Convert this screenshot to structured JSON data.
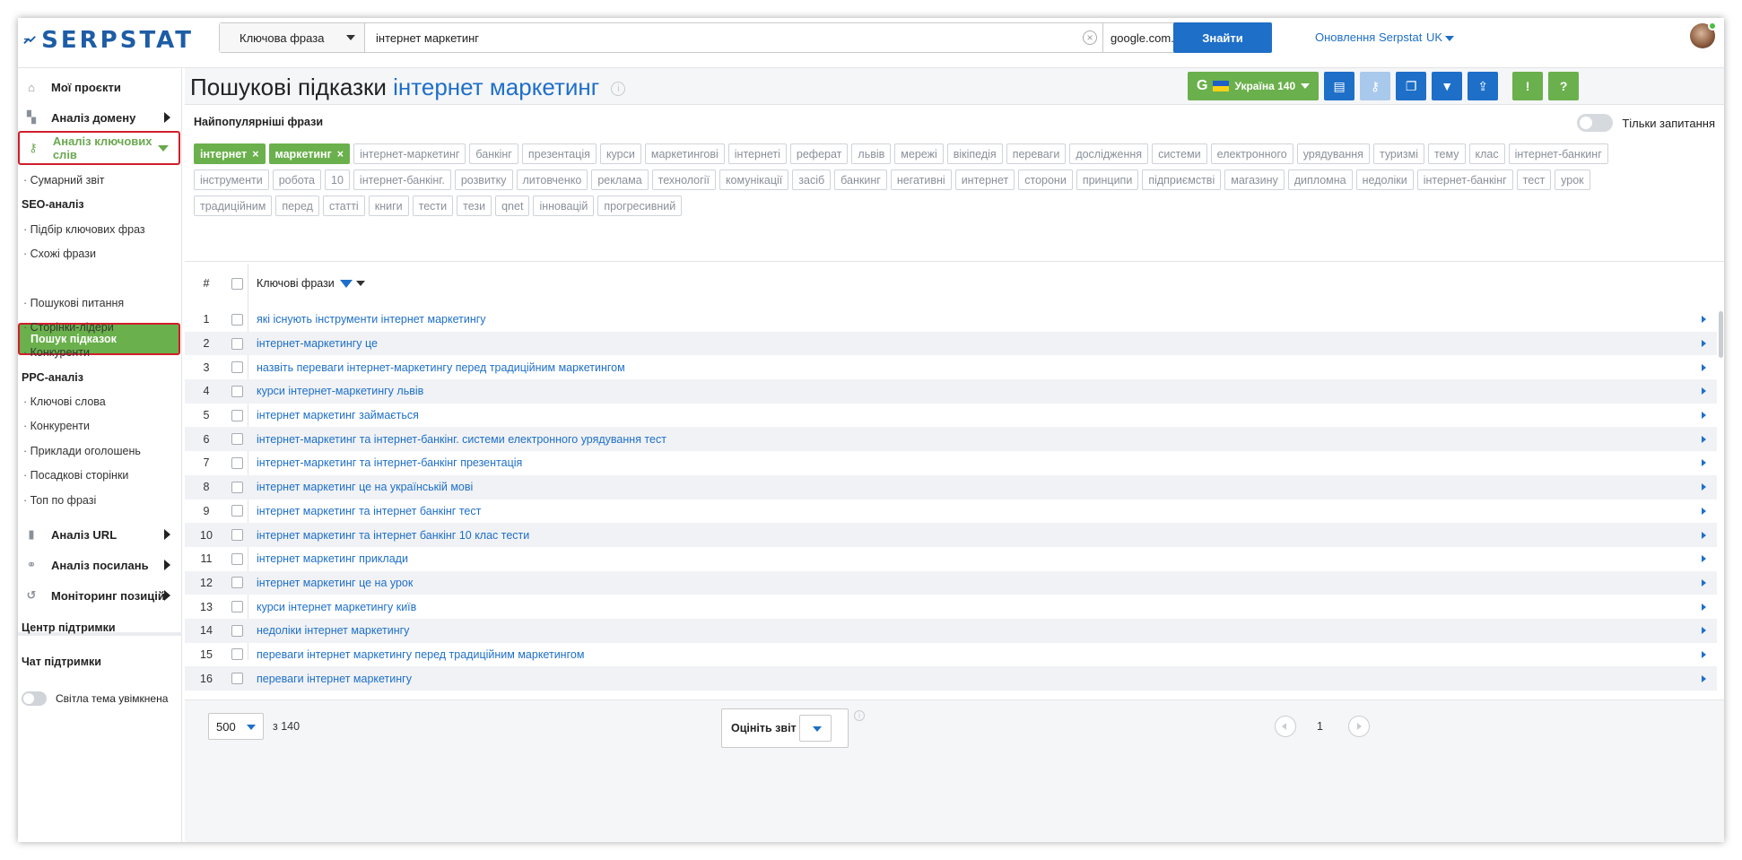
{
  "brand": {
    "logo_text": "SERPSTAT",
    "primary": "#1e6fc8",
    "green": "#6ab04c",
    "annotation_red": "#d01e2a"
  },
  "search": {
    "type_label": "Ключова фраза",
    "query": "інтернет маркетинг",
    "database": "google.com.ua",
    "submit_label": "Знайти"
  },
  "header": {
    "updates_label": "Оновлення Serpstat",
    "lang": "UK"
  },
  "sidebar": {
    "projects": "Мої проєкти",
    "domain_analysis": "Аналіз домену",
    "keyword_analysis": "Аналіз ключових слів",
    "summary": "Сумарний звіт",
    "seo_head": "SEO-аналіз",
    "seo_items": [
      "Підбір ключових фраз",
      "Схожі фрази",
      "Пошук підказок",
      "Пошукові питання",
      "Сторінки-лідери",
      "Конкуренти"
    ],
    "ppc_head": "PPC-аналіз",
    "ppc_items": [
      "Ключові слова",
      "Конкуренти",
      "Приклади оголошень",
      "Посадкові сторінки",
      "Топ по фразі"
    ],
    "url_analysis": "Аналіз URL",
    "links_analysis": "Аналіз посилань",
    "rank_tracking": "Моніторинг позицій",
    "support_center": "Центр підтримки",
    "support_chat": "Чат підтримки",
    "theme": "Світла тема увімкнена"
  },
  "page": {
    "title": "Пошукові підказки",
    "title_keyword": "інтернет маркетинг",
    "region_label": "Україна 140",
    "popular_title": "Найпопулярніші фрази",
    "only_questions": "Тільки запитання"
  },
  "tags": [
    {
      "label": "інтернет",
      "selected": true
    },
    {
      "label": "маркетинг",
      "selected": true
    },
    {
      "label": "інтернет-маркетинг"
    },
    {
      "label": "банкінг"
    },
    {
      "label": "презентація"
    },
    {
      "label": "курси"
    },
    {
      "label": "маркетингові"
    },
    {
      "label": "інтернеті"
    },
    {
      "label": "реферат"
    },
    {
      "label": "львів"
    },
    {
      "label": "мережі"
    },
    {
      "label": "вікіпедія"
    },
    {
      "label": "переваги"
    },
    {
      "label": "дослідження"
    },
    {
      "label": "системи"
    },
    {
      "label": "електронного"
    },
    {
      "label": "урядування"
    },
    {
      "label": "туризмі"
    },
    {
      "label": "тему"
    },
    {
      "label": "клас"
    },
    {
      "label": "інтернет-банкинг"
    },
    {
      "label": "інструменти"
    },
    {
      "label": "робота"
    },
    {
      "label": "10"
    },
    {
      "label": "інтернет-банкінг."
    },
    {
      "label": "розвитку"
    },
    {
      "label": "литовченко"
    },
    {
      "label": "реклама"
    },
    {
      "label": "технології"
    },
    {
      "label": "комунікації"
    },
    {
      "label": "засіб"
    },
    {
      "label": "банкинг"
    },
    {
      "label": "негативні"
    },
    {
      "label": "интернет"
    },
    {
      "label": "сторони"
    },
    {
      "label": "принципи"
    },
    {
      "label": "підприємстві"
    },
    {
      "label": "магазину"
    },
    {
      "label": "дипломна"
    },
    {
      "label": "недоліки"
    },
    {
      "label": "інтернет-банкінг"
    },
    {
      "label": "тест"
    },
    {
      "label": "урок"
    },
    {
      "label": "традиційним"
    },
    {
      "label": "перед"
    },
    {
      "label": "статті"
    },
    {
      "label": "книги"
    },
    {
      "label": "тести"
    },
    {
      "label": "тези"
    },
    {
      "label": "qnet"
    },
    {
      "label": "інновацій"
    },
    {
      "label": "прогресивний"
    }
  ],
  "table": {
    "col_num": "#",
    "col_keywords": "Ключові фрази",
    "rows": [
      {
        "n": "1",
        "kw": "які існують інструменти інтернет маркетингу"
      },
      {
        "n": "2",
        "kw": "інтернет-маркетингу це"
      },
      {
        "n": "3",
        "kw": "назвіть переваги інтернет-маркетингу перед традиційним маркетингом"
      },
      {
        "n": "4",
        "kw": "курси інтернет-маркетингу львів"
      },
      {
        "n": "5",
        "kw": "інтернет маркетинг займається"
      },
      {
        "n": "6",
        "kw": "інтернет-маркетинг та інтернет-банкінг. системи електронного урядування тест"
      },
      {
        "n": "7",
        "kw": "інтернет-маркетинг та інтернет-банкінг презентація"
      },
      {
        "n": "8",
        "kw": "інтернет маркетинг це на українській мові"
      },
      {
        "n": "9",
        "kw": "інтернет маркетинг та інтернет банкінг тест"
      },
      {
        "n": "10",
        "kw": "інтернет маркетинг та інтернет банкінг 10 клас тести"
      },
      {
        "n": "11",
        "kw": "інтернет маркетинг приклади"
      },
      {
        "n": "12",
        "kw": "інтернет маркетинг це на урок"
      },
      {
        "n": "13",
        "kw": "курси інтернет маркетингу київ"
      },
      {
        "n": "14",
        "kw": "недоліки інтернет маркетингу"
      },
      {
        "n": "15",
        "kw": "переваги інтернет маркетингу перед традиційним маркетингом"
      },
      {
        "n": "16",
        "kw": "переваги інтернет маркетингу"
      }
    ]
  },
  "footer": {
    "per_page": "500",
    "of_total": "з 140",
    "rate_label": "Оцініть звіт",
    "page": "1"
  }
}
